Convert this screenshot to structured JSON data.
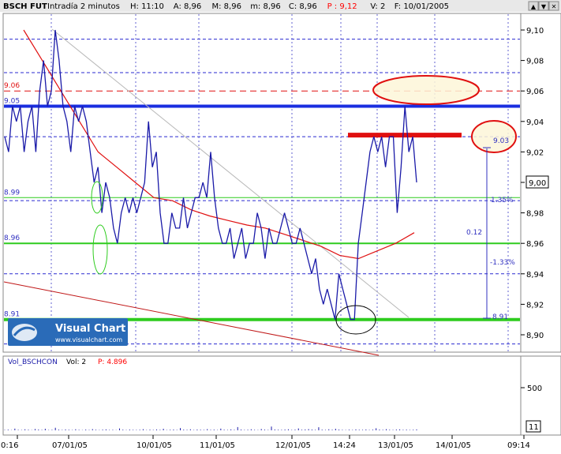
{
  "header": {
    "symbol": "BSCH FUT",
    "interval": "Intradía 2 minutos",
    "fields": [
      {
        "label": "H:",
        "value": "11:10",
        "color": "#000000"
      },
      {
        "label": "A:",
        "value": "8,96",
        "color": "#000000"
      },
      {
        "label": "M:",
        "value": "8,96",
        "color": "#000000"
      },
      {
        "label": "m:",
        "value": "8,96",
        "color": "#000000"
      },
      {
        "label": "C:",
        "value": "8,96",
        "color": "#000000"
      },
      {
        "label": "P :",
        "value": "9,12",
        "color": "#ff0000"
      },
      {
        "label": "V:",
        "value": "2",
        "color": "#000000"
      },
      {
        "label": "F:",
        "value": "10/01/2005",
        "color": "#000000"
      }
    ]
  },
  "window_controls": [
    "▲",
    "▼",
    "✕"
  ],
  "volume_header": {
    "name": "Vol_BSCHCON",
    "vol_label": "Vol: 2",
    "p_label": "P: 4.896"
  },
  "watermark": {
    "brand": "Visual Chart",
    "url": "www.visualchart.com"
  },
  "colors": {
    "price": "#1a1aa8",
    "ma": "#e01010",
    "support": "#2ecc1e",
    "resistance": "#1a2ee0",
    "dashed": "#2a2ad0",
    "annotation": "#3030c0"
  },
  "chart_data": {
    "type": "line",
    "title": "BSCH FUT Intradía 2 minutos",
    "y_axis": {
      "ticks": [
        "9,10",
        "9,08",
        "9,06",
        "9,04",
        "9,02",
        "9,00",
        "8,98",
        "8,96",
        "8,94",
        "8,92",
        "8,90"
      ],
      "min": 8.885,
      "max": 9.11,
      "current_value": "9,00"
    },
    "x_axis": {
      "ticks": [
        "0:16",
        "07/01/05",
        "10/01/05",
        "11/01/05",
        "12/01/05",
        "14:24",
        "13/01/05",
        "14/01/05",
        "09:14"
      ]
    },
    "series": [
      {
        "role": "price",
        "values": [
          9.03,
          9.02,
          9.05,
          9.04,
          9.05,
          9.02,
          9.04,
          9.05,
          9.02,
          9.06,
          9.08,
          9.05,
          9.06,
          9.1,
          9.08,
          9.05,
          9.04,
          9.02,
          9.05,
          9.04,
          9.05,
          9.04,
          9.02,
          9.0,
          9.01,
          8.98,
          9.0,
          8.99,
          8.97,
          8.96,
          8.98,
          8.99,
          8.98,
          8.99,
          8.98,
          8.99,
          9.0,
          9.04,
          9.01,
          9.02,
          8.98,
          8.96,
          8.96,
          8.98,
          8.97,
          8.97,
          8.99,
          8.97,
          8.98,
          8.99,
          8.99,
          9.0,
          8.99,
          9.02,
          8.99,
          8.97,
          8.96,
          8.96,
          8.97,
          8.95,
          8.96,
          8.97,
          8.95,
          8.96,
          8.96,
          8.98,
          8.97,
          8.95,
          8.97,
          8.96,
          8.96,
          8.97,
          8.98,
          8.97,
          8.96,
          8.96,
          8.97,
          8.96,
          8.95,
          8.94,
          8.95,
          8.93,
          8.92,
          8.93,
          8.92,
          8.91,
          8.94,
          8.93,
          8.92,
          8.91,
          8.91,
          8.96,
          8.98,
          9.0,
          9.02,
          9.03,
          9.02,
          9.03,
          9.01,
          9.03,
          9.03,
          8.98,
          9.01,
          9.05,
          9.02,
          9.03,
          9.0
        ]
      },
      {
        "role": "moving-average",
        "values": [
          9.1,
          9.08,
          9.06,
          9.04,
          9.02,
          9.01,
          9.0,
          8.99,
          8.988,
          8.982,
          8.978,
          8.975,
          8.972,
          8.97,
          8.966,
          8.962,
          8.958,
          8.952,
          8.95,
          8.955,
          8.96,
          8.967
        ]
      }
    ],
    "levels": [
      {
        "price": 9.05,
        "label": "9.05",
        "style": "solid-thick",
        "color": "#1a2ee0"
      },
      {
        "price": 9.06,
        "label": "9.06",
        "style": "dashed",
        "color": "#e01010"
      },
      {
        "price": 8.99,
        "label": "8.99",
        "style": "solid-thin",
        "color": "#2ecc1e"
      },
      {
        "price": 8.96,
        "label": "8.96",
        "style": "solid",
        "color": "#2ecc1e"
      },
      {
        "price": 8.91,
        "label": "8.91",
        "style": "solid-thick",
        "color": "#2ecc1e"
      },
      {
        "price": 9.031,
        "label": "",
        "style": "segment-thick",
        "color": "#e01010"
      }
    ],
    "dashed_levels": [
      9.094,
      9.072,
      9.03,
      8.988,
      8.94,
      8.894
    ],
    "annotations": [
      {
        "text": "9.03"
      },
      {
        "text": "1.35%"
      },
      {
        "text": "0.12"
      },
      {
        "text": "-1.33%"
      },
      {
        "text": "8.91"
      }
    ],
    "volume": {
      "y_ticks": [
        "500"
      ],
      "current_value": "11",
      "values": [
        5,
        8,
        3,
        20,
        6,
        4,
        12,
        7,
        3,
        15,
        9,
        5,
        18,
        4,
        6,
        30,
        8,
        5,
        10,
        7,
        4,
        12,
        6,
        3,
        9,
        5,
        14,
        7,
        4,
        8,
        11,
        5,
        6,
        3,
        22,
        8,
        4,
        9,
        6,
        5,
        7,
        13,
        4,
        8,
        5,
        10,
        6,
        18,
        4,
        7,
        9,
        5,
        26,
        8,
        6,
        12,
        4,
        9,
        7,
        5,
        14,
        6,
        8,
        4,
        20,
        7,
        5,
        11,
        6,
        38,
        9,
        5,
        7,
        12,
        6,
        4,
        15,
        8,
        5,
        44,
        10,
        7,
        6,
        9,
        12,
        5,
        8,
        22,
        7,
        10,
        14,
        9,
        6,
        36,
        8,
        5,
        12,
        7,
        18,
        9,
        6,
        4,
        8,
        5,
        11,
        7,
        6,
        10,
        5,
        8,
        24,
        9,
        6,
        13,
        7,
        5,
        9,
        11,
        6,
        8,
        5,
        7,
        10
      ]
    }
  }
}
